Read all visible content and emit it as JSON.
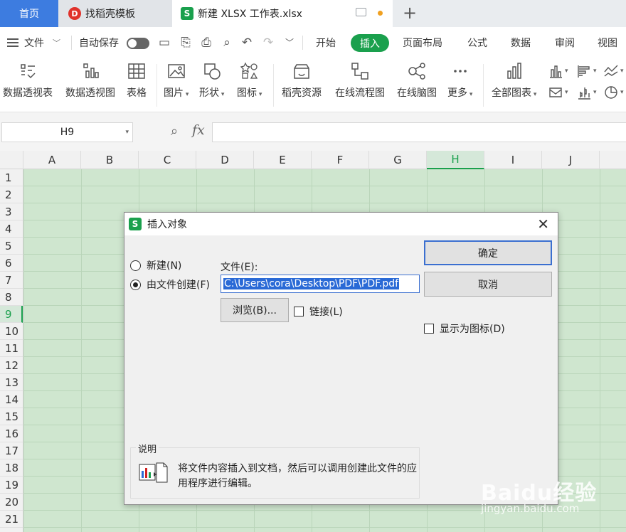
{
  "tabs": {
    "home": "首页",
    "daoke": "找稻壳模板",
    "active": "新建 XLSX 工作表.xlsx"
  },
  "menu": {
    "file": "文件",
    "autosave": "自动保存",
    "items": [
      "开始",
      "插入",
      "页面布局",
      "公式",
      "数据",
      "审阅",
      "视图"
    ]
  },
  "ribbon": {
    "pivot_table": "数据透视表",
    "pivot_chart": "数据透视图",
    "table": "表格",
    "picture": "图片",
    "shape": "形状",
    "icon": "图标",
    "daoke_resource": "稻壳资源",
    "flowchart": "在线流程图",
    "mindmap": "在线脑图",
    "more": "更多",
    "all_charts": "全部图表"
  },
  "formula_bar": {
    "cell_ref": "H9",
    "fx": "fx",
    "value": ""
  },
  "grid": {
    "columns": [
      "A",
      "B",
      "C",
      "D",
      "E",
      "F",
      "G",
      "H",
      "I",
      "J"
    ],
    "selected_column": "H",
    "rows": [
      "1",
      "2",
      "3",
      "4",
      "5",
      "6",
      "7",
      "8",
      "9",
      "10",
      "11",
      "12",
      "13",
      "14",
      "15",
      "16",
      "17",
      "18",
      "19",
      "20",
      "21"
    ],
    "selected_row": "9"
  },
  "dialog": {
    "title": "插入对象",
    "radio_new": "新建(N)",
    "radio_from_file": "由文件创建(F)",
    "file_label": "文件(E):",
    "file_path": "C:\\Users\\cora\\Desktop\\PDF\\PDF.pdf",
    "browse": "浏览(B)...",
    "link": "链接(L)",
    "ok": "确定",
    "cancel": "取消",
    "show_as_icon": "显示为图标(D)",
    "description_title": "说明",
    "description": "将文件内容插入到文档，然后可以调用创建此文件的应用程序进行编辑。"
  },
  "watermark": {
    "brand": "Baidu经验",
    "url": "jingyan.baidu.com"
  },
  "colors": {
    "accent_green": "#1aa04d",
    "home_tab_blue": "#3d7ce0",
    "grid_green": "#cfe6cf",
    "selection_blue": "#2a6ad6"
  }
}
